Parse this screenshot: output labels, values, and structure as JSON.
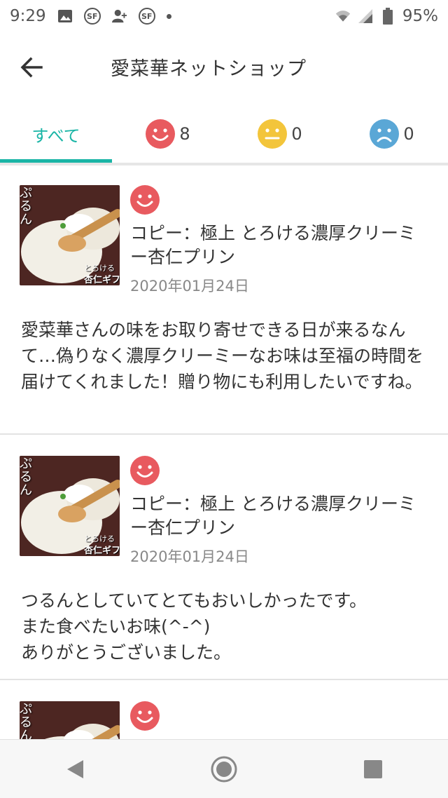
{
  "status_bar": {
    "time": "9:29",
    "battery": "95%",
    "sf_label": "SF"
  },
  "header": {
    "title": "愛菜華ネットショップ",
    "back_icon": "arrow-left-icon"
  },
  "tabs": [
    {
      "label": "すべて",
      "active": true
    },
    {
      "icon": "smile-face-icon",
      "count": "8",
      "color": "#e85a5f"
    },
    {
      "icon": "neutral-face-icon",
      "count": "0",
      "color": "#f3c53b"
    },
    {
      "icon": "sad-face-icon",
      "count": "0",
      "color": "#5aa7d6"
    }
  ],
  "reviews": [
    {
      "rating_icon": "smile-face-icon",
      "thumb_text_1": "ぷるん",
      "thumb_text_2": "とろける",
      "thumb_text_3": "杏仁ギフト",
      "product": "コピー：極上 とろける濃厚クリーミー杏仁プリン",
      "date": "2020年01月24日",
      "body": "愛菜華さんの味をお取り寄せできる日が来るなんて…偽りなく濃厚クリーミーなお味は至福の時間を届けてくれました！贈り物にも利用したいですね。"
    },
    {
      "rating_icon": "smile-face-icon",
      "thumb_text_1": "ぷるん",
      "thumb_text_2": "とろける",
      "thumb_text_3": "杏仁ギフト",
      "product": "コピー：極上 とろける濃厚クリーミー杏仁プリン",
      "date": "2020年01月24日",
      "body": "つるんとしていてとてもおいしかったです。\nまた食べたいお味(^-^)\nありがとうございました。"
    },
    {
      "rating_icon": "smile-face-icon",
      "thumb_text_1": "ぷるん"
    }
  ],
  "colors": {
    "accent": "#1ab5a6",
    "smile": "#e85a5f"
  }
}
